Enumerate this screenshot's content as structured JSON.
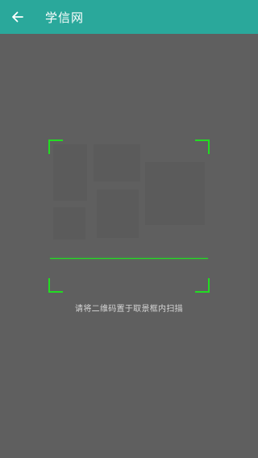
{
  "app_bar": {
    "title": "学信网",
    "back_icon": "arrow-left-icon",
    "background_color": "#2aa89b"
  },
  "scanner": {
    "hint_text": "请将二维码置于取景框内扫描",
    "frame_color": "#22dd22",
    "overlay_color": "#5f5f5f"
  }
}
